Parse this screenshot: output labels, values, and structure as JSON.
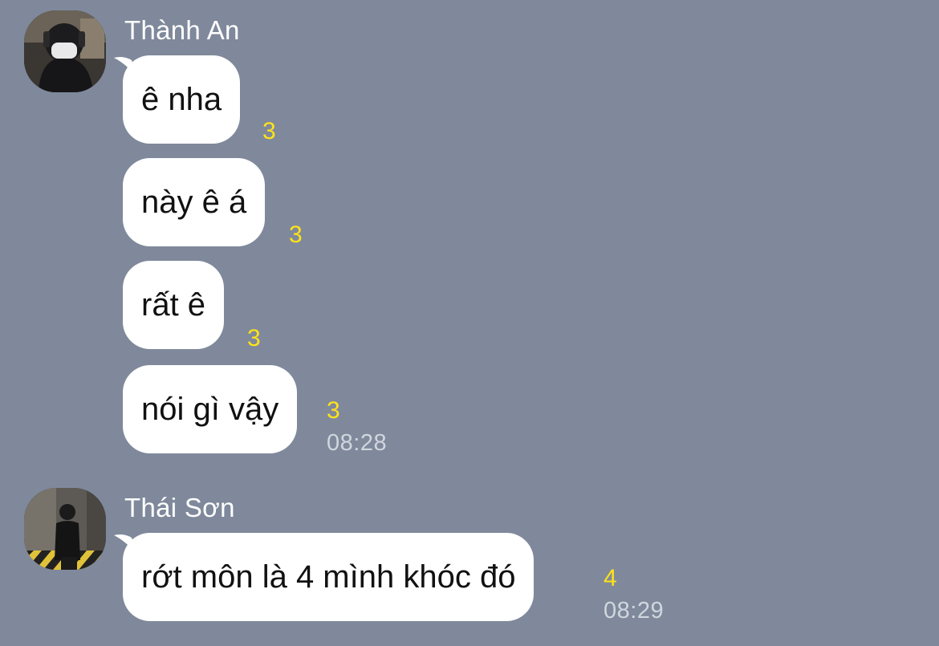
{
  "messages": [
    {
      "sender": "Thành An",
      "items": [
        {
          "text": "ê nha",
          "read": "3"
        },
        {
          "text": "này ê á",
          "read": "3"
        },
        {
          "text": "rất ê",
          "read": "3"
        },
        {
          "text": "nói gì vậy",
          "read": "3",
          "time": "08:28"
        }
      ]
    },
    {
      "sender": "Thái Sơn",
      "items": [
        {
          "text": "rớt môn là 4 mình khóc đó",
          "read": "4",
          "time": "08:29"
        }
      ]
    }
  ],
  "colors": {
    "background": "#7f899b",
    "bubble": "#ffffff",
    "read_count": "#ffe21a",
    "timestamp": "#d1d6de"
  },
  "icons": {
    "avatar_1": "user-avatar-photo",
    "avatar_2": "user-avatar-photo"
  }
}
